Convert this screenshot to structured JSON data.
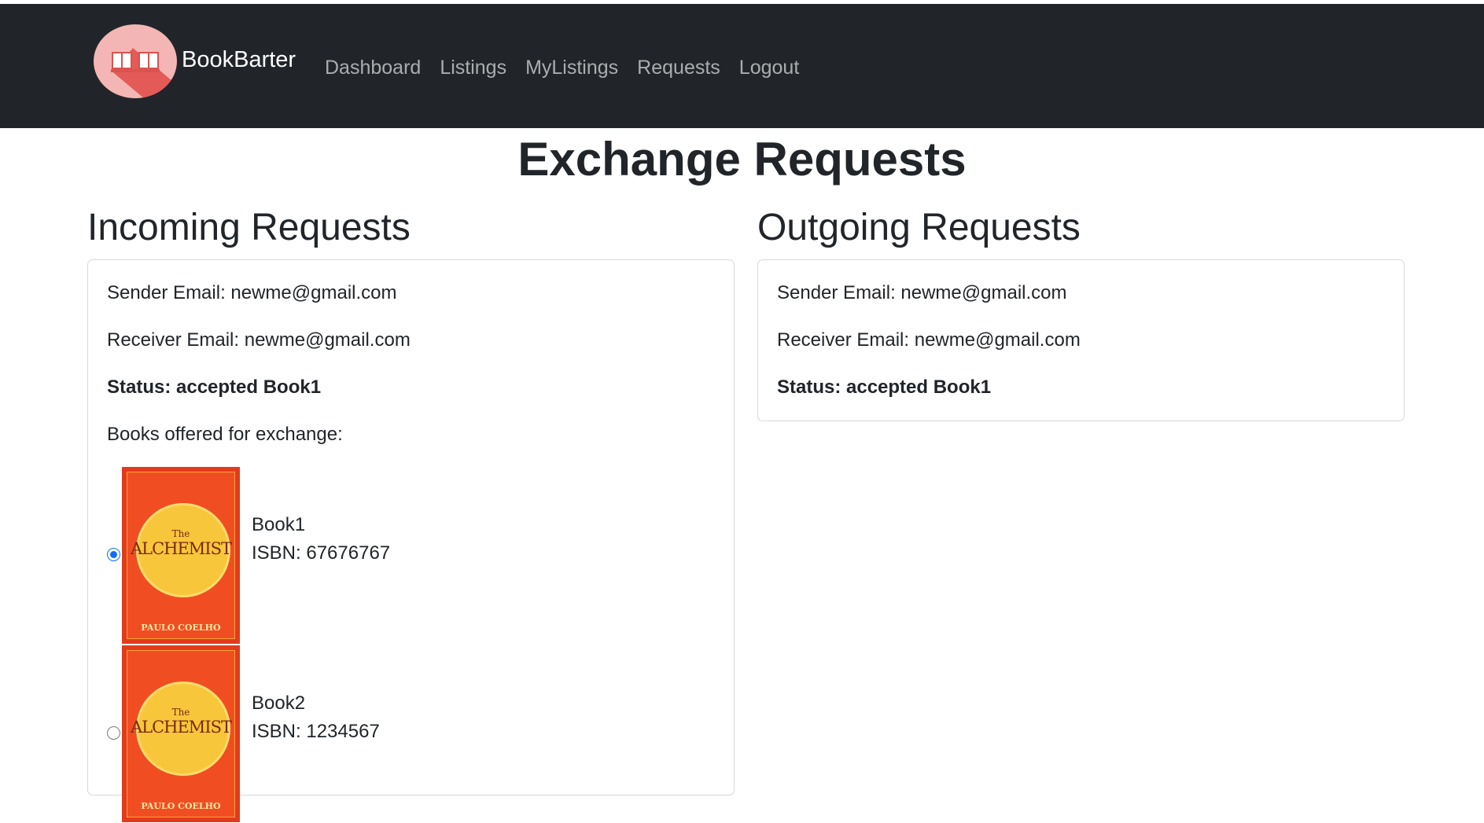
{
  "navbar": {
    "brand": "BookBarter",
    "links": [
      "Dashboard",
      "Listings",
      "MyListings",
      "Requests",
      "Logout"
    ]
  },
  "page_title": "Exchange Requests",
  "incoming": {
    "title": "Incoming Requests",
    "sender": "Sender Email: newme@gmail.com",
    "receiver": "Receiver Email: newme@gmail.com",
    "status": "Status: accepted Book1",
    "books_label": "Books offered for exchange:",
    "books": [
      {
        "name": "Book1",
        "isbn": "ISBN: 67676767",
        "selected": true,
        "cover_the": "The",
        "cover_title": "ALCHEMIST",
        "cover_author": "PAULO COELHO"
      },
      {
        "name": "Book2",
        "isbn": "ISBN: 1234567",
        "selected": false,
        "cover_the": "The",
        "cover_title": "ALCHEMIST",
        "cover_author": "PAULO COELHO"
      }
    ]
  },
  "outgoing": {
    "title": "Outgoing Requests",
    "sender": "Sender Email: newme@gmail.com",
    "receiver": "Receiver Email: newme@gmail.com",
    "status": "Status: accepted Book1"
  },
  "colors": {
    "navbar_bg": "#212529",
    "radio_accent": "#0d6efd",
    "cover_red": "#e23b1c",
    "cover_sun": "#f7c63a"
  }
}
